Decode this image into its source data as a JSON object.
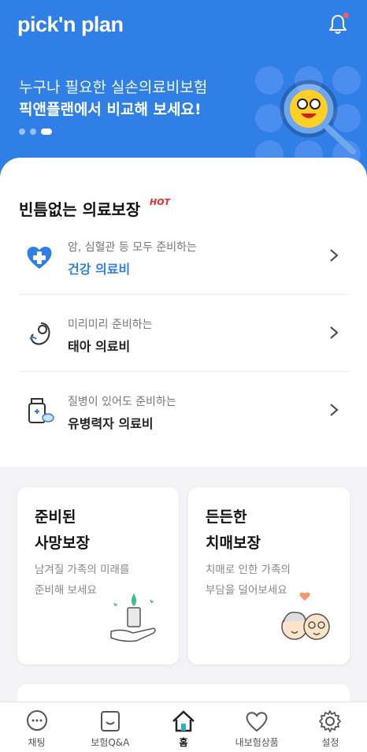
{
  "app": {
    "logo_text": "pick'n plan"
  },
  "hero": {
    "line1": "누구나 필요한 실손의료비보험",
    "line2": "픽앤플랜에서 비교해 보세요!",
    "carousel_count": 3,
    "carousel_active": 3
  },
  "section": {
    "title": "빈틈없는 의료보장",
    "badge": "HOT",
    "items": [
      {
        "subtitle": "암, 심혈관 등 모두 준비하는",
        "title": "건강 의료비",
        "icon": "heart-plus-icon"
      },
      {
        "subtitle": "미리미리 준비하는",
        "title": "태아 의료비",
        "icon": "fetus-icon"
      },
      {
        "subtitle": "질병이 있어도 준비하는",
        "title": "유병력자 의료비",
        "icon": "medicine-bottle-icon"
      }
    ]
  },
  "cards": [
    {
      "title_line1": "준비된",
      "title_line2": "사망보장",
      "desc_line1": "남겨질 가족의 미래를",
      "desc_line2": "준비해 보세요",
      "icon": "candle-hand-icon"
    },
    {
      "title_line1": "든든한",
      "title_line2": "치매보장",
      "desc_line1": "치매로 인한 가족의",
      "desc_line2": "부담을 덜어보세요",
      "icon": "elderly-couple-icon"
    }
  ],
  "tabs": [
    {
      "label": "채팅",
      "icon": "chat-icon"
    },
    {
      "label": "보험Q&A",
      "icon": "qna-icon"
    },
    {
      "label": "홈",
      "icon": "home-icon",
      "active": true
    },
    {
      "label": "내보험상품",
      "icon": "heart-icon"
    },
    {
      "label": "설정",
      "icon": "gear-icon"
    }
  ],
  "colors": {
    "primary": "#2f7fe6",
    "hot": "#e02b2b",
    "background": "#f3f3f5"
  }
}
